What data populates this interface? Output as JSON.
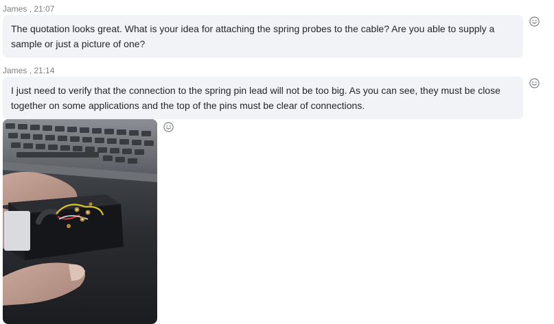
{
  "messages": [
    {
      "sender": "James",
      "separator": ",",
      "time": "21:07",
      "text": "The quotation looks great. What is your idea for attaching the spring probes to the cable? Are you able to supply a sample or just a picture of one?"
    },
    {
      "sender": "James",
      "separator": ",",
      "time": "21:14",
      "text": "I just need to verify that the connection to the spring pin lead will not be too big. As you can see, they must be close together on some applications and the top of the pins must be clear of connections."
    }
  ],
  "icons": {
    "reaction": "smiley-face-icon"
  },
  "colors": {
    "bubble_bg": "#f1f3f6",
    "meta_text": "#7b7f86",
    "body_text": "#23262a"
  }
}
